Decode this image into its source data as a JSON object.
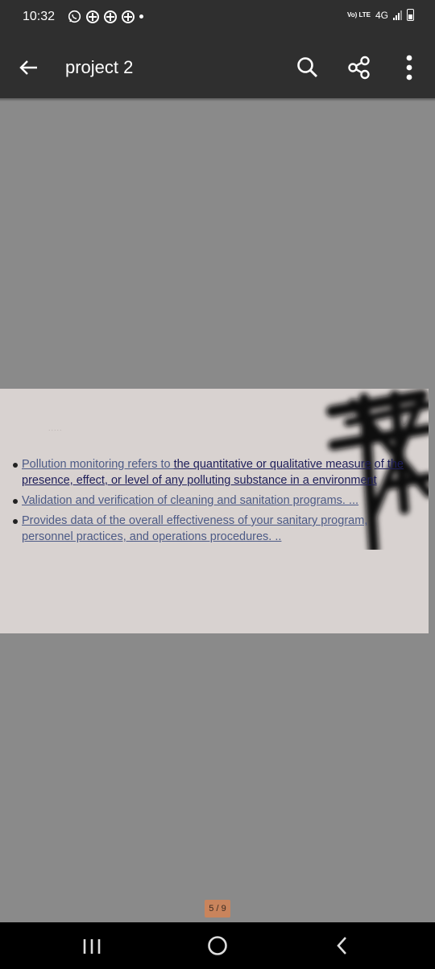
{
  "status_bar": {
    "time": "10:32",
    "network_volte": "Vo) LTE",
    "network_type": "4G",
    "left_icons": [
      "whatsapp-icon",
      "notification-grid-icon",
      "notification-grid-icon",
      "notification-grid-icon",
      "more-notifications-dot"
    ]
  },
  "app_bar": {
    "title": "project 2",
    "actions": [
      "search-icon",
      "share-icon",
      "more-vert-icon"
    ],
    "background": "#2f2f2f"
  },
  "document": {
    "page_background": "#d8d2d0",
    "viewer_background": "#8a8a8a",
    "dots": ".....",
    "bullets": [
      {
        "prefix": "Pollution monitoring refers to ",
        "highlight": "the quantitative or qualitative measure",
        "rest": "of the presence, effect, or level of any polluting substance in a environment"
      },
      {
        "text": "Validation and verification of cleaning and sanitation programs. ..."
      },
      {
        "text": "Provides data of the overall effectiveness of your sanitary program, personnel practices, and operations procedures. .."
      }
    ]
  },
  "page_indicator": {
    "label": "5 / 9",
    "current": 5,
    "total": 9,
    "color": "#c9845c"
  },
  "nav_bar": {
    "buttons": [
      "recents-icon",
      "home-icon",
      "back-icon"
    ]
  }
}
